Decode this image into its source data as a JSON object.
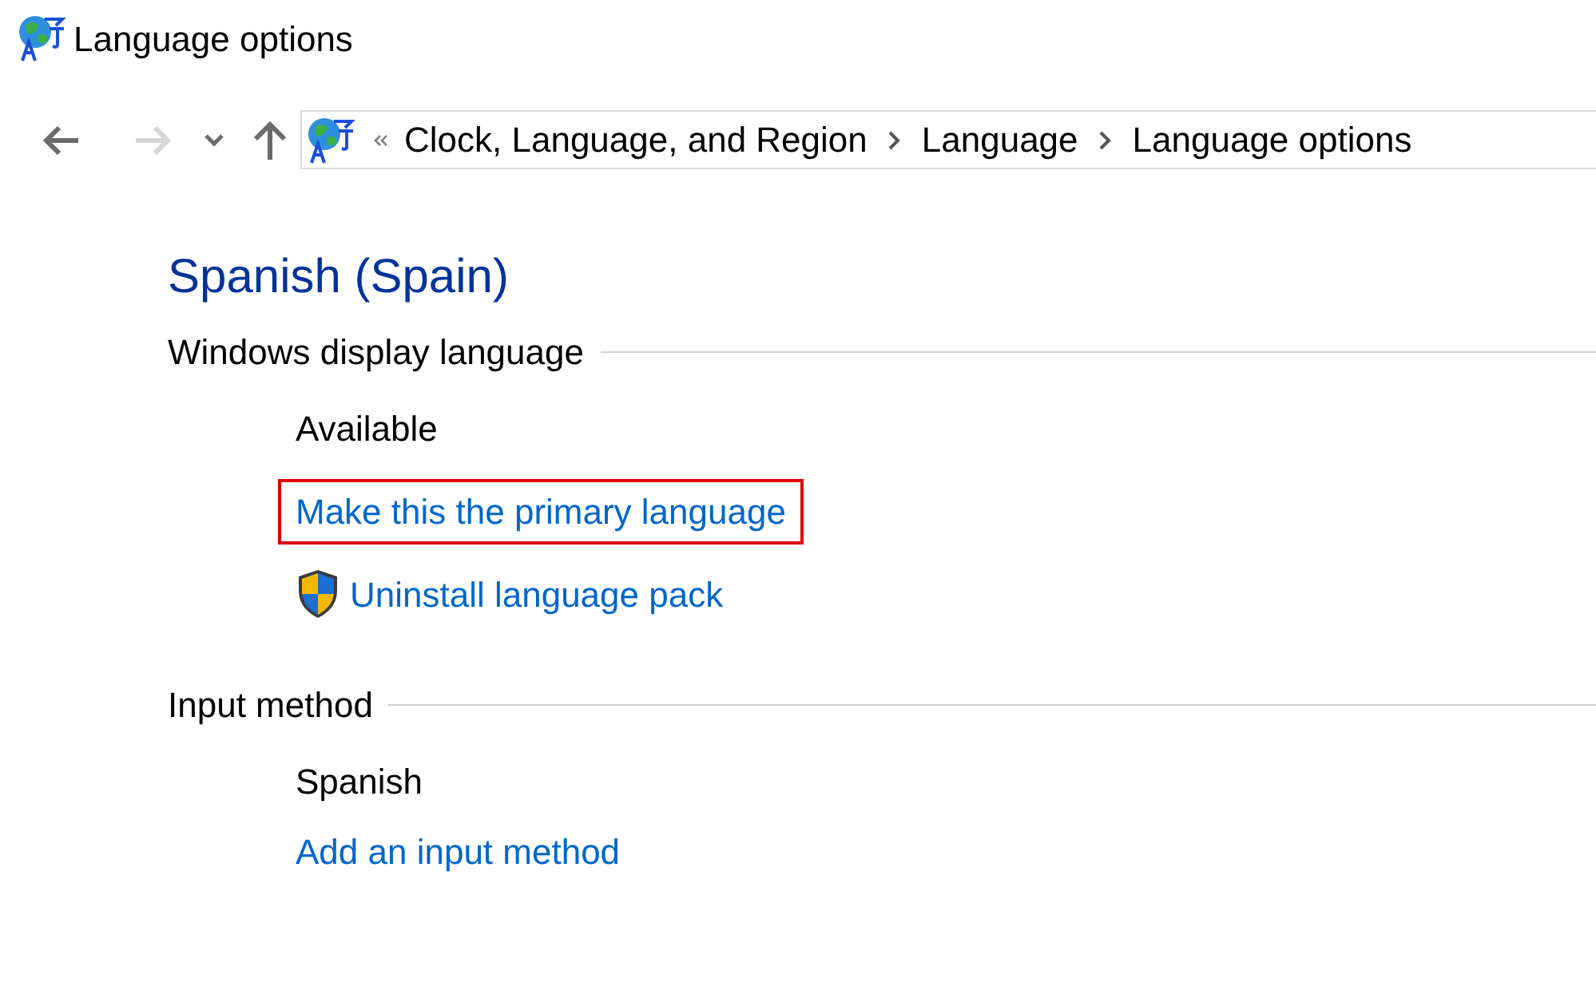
{
  "window": {
    "title": "Language options"
  },
  "navigation": {
    "back_enabled": true,
    "forward_enabled": false,
    "breadcrumb": [
      "Clock, Language, and Region",
      "Language",
      "Language options"
    ]
  },
  "heading": "Spanish (Spain)",
  "sections": [
    {
      "title": "Windows display language",
      "items": [
        {
          "kind": "text",
          "label": "Available"
        },
        {
          "kind": "link",
          "label": "Make this the primary language",
          "highlighted": true,
          "shield": false
        },
        {
          "kind": "link",
          "label": "Uninstall language pack",
          "highlighted": false,
          "shield": true
        }
      ]
    },
    {
      "title": "Input method",
      "items": [
        {
          "kind": "text",
          "label": "Spanish"
        },
        {
          "kind": "link",
          "label": "Add an input method",
          "highlighted": false,
          "shield": false
        }
      ]
    }
  ]
}
